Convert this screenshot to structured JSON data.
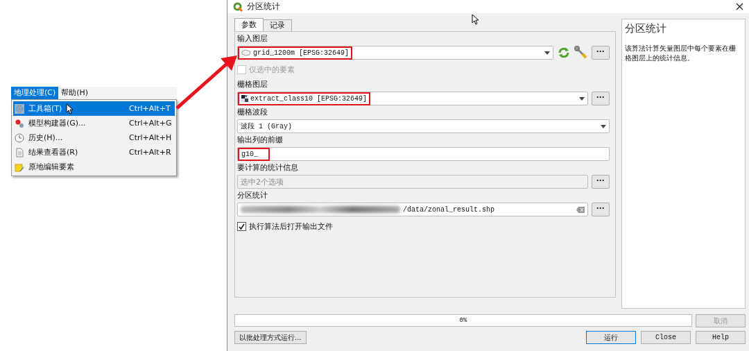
{
  "menu": {
    "menubar": [
      {
        "label": "地理处理(C)",
        "selected": true
      },
      {
        "label": "帮助(H)",
        "selected": false
      }
    ],
    "items": [
      {
        "kind": "toolbox",
        "label": "工具箱(T)",
        "shortcut": "Ctrl+Alt+T",
        "selected": true
      },
      {
        "kind": "model",
        "label": "模型构建器(G)...",
        "shortcut": "Ctrl+Alt+G",
        "selected": false
      },
      {
        "kind": "history",
        "label": "历史(H)...",
        "shortcut": "Ctrl+Alt+H",
        "selected": false
      },
      {
        "kind": "results",
        "label": "结果查看器(R)",
        "shortcut": "Ctrl+Alt+R",
        "selected": false
      },
      {
        "kind": "edit",
        "label": "原地编辑要素",
        "selected": false
      }
    ]
  },
  "dialog": {
    "title": "分区统计",
    "tabs": [
      {
        "label": "参数",
        "selected": true
      },
      {
        "label": "记录",
        "selected": false
      }
    ],
    "input_layer": {
      "more_button": "···",
      "label": "输入图层",
      "value": "grid_1200m [EPSG:32649]",
      "highlighted": true
    },
    "selected_only": {
      "label": "仅选中的要素",
      "checked": false,
      "disabled": true
    },
    "raster_layer": {
      "more_button": "···",
      "label": "栅格图层",
      "value": "extract_class10 [EPSG:32649]",
      "highlighted": true
    },
    "band": {
      "label": "栅格波段",
      "value": "波段 1 (Gray)"
    },
    "prefix": {
      "label": "输出列的前缀",
      "value": "g10_",
      "highlighted": true
    },
    "statistics": {
      "more_button": "···",
      "label": "要计算的统计信息",
      "placeholder": "选中2个选项"
    },
    "output": {
      "more_button": "···",
      "label": "分区统计",
      "value": "/data/zonal_result.shp"
    },
    "open_after": {
      "label": "执行算法后打开输出文件",
      "checked": true
    },
    "help": {
      "title": "分区统计",
      "text": "该算法计算矢量图层中每个要素在栅格图层上的统计信息。"
    },
    "progress": {
      "level": 0,
      "reading": "0%"
    },
    "buttons": {
      "batch": "以批处理方式运行...",
      "cancel": "取消",
      "run": "运行",
      "close": "Close",
      "help": "Help"
    }
  }
}
